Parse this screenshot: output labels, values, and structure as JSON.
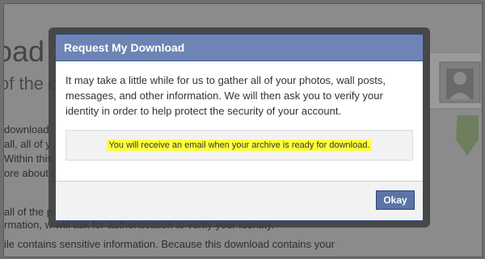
{
  "background": {
    "heading": "oad Y",
    "subheading": "of the c",
    "lines": [
      "download",
      "all, all of y",
      "Within this",
      "ore about c",
      "all of the p",
      "rmation, w              will ask for authentication to verify your identity.",
      "ile contains sensitive information. Because this download contains your"
    ]
  },
  "dialog": {
    "title": "Request My Download",
    "message": "It may take a little while for us to gather all of your photos, wall posts, messages, and other information. We will then ask you to verify your identity in order to help protect the security of your account.",
    "notice": "You will receive an email when your archive is ready for download.",
    "okay_label": "Okay"
  }
}
